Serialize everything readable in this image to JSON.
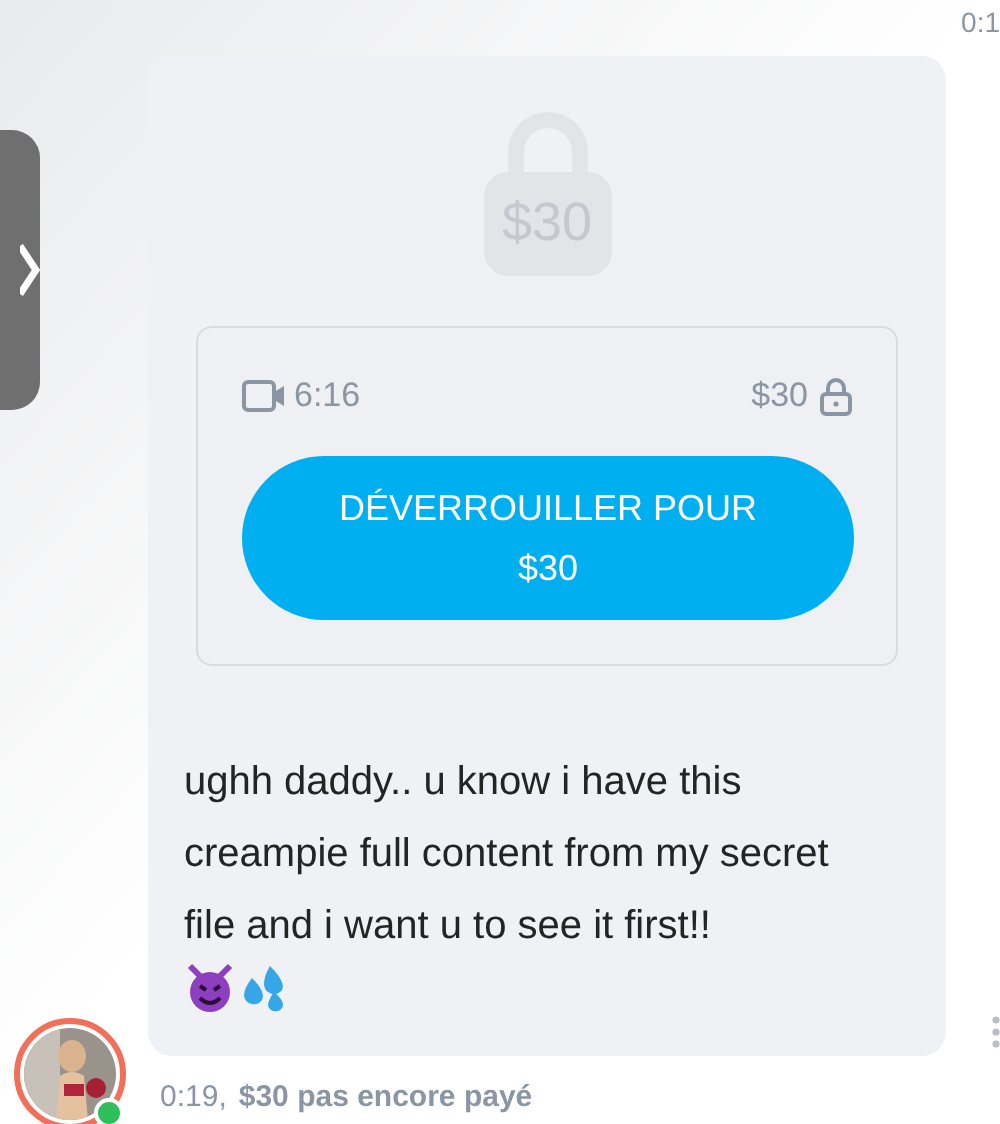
{
  "top_time": "0:1",
  "locked_media": {
    "preview_price": "$30",
    "duration": "6:16",
    "price": "$30",
    "unlock_button": "DÉVERROUILLER POUR $30"
  },
  "message": {
    "text": "ughh daddy.. u know i have this creampie full content from my secret file and i want u to see it first!!",
    "online": true
  },
  "footer": {
    "time": "0:19,",
    "status": "$30 pas encore payé"
  }
}
